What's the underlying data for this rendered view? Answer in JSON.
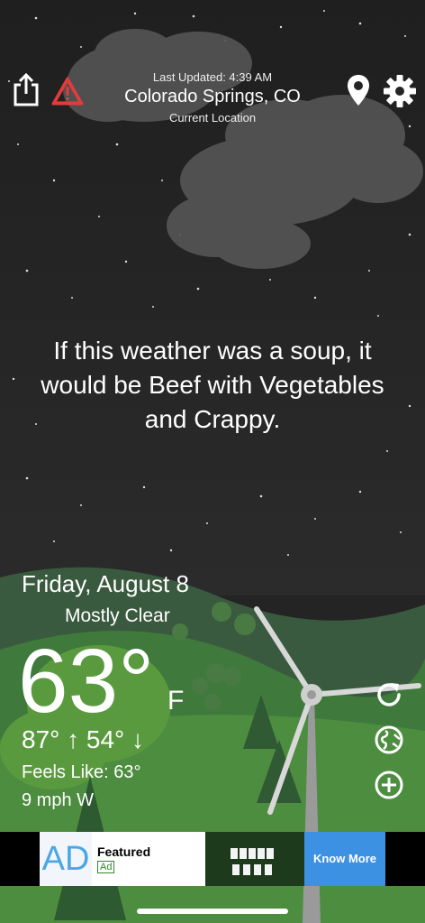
{
  "header": {
    "last_updated": "Last Updated: 4:39 AM",
    "city": "Colorado Springs, CO",
    "location_label": "Current Location"
  },
  "quote": "If this weather was a soup, it would be Beef with Vegetables and Crappy.",
  "current": {
    "date": "Friday, August 8",
    "condition": "Mostly Clear",
    "temperature": "63°",
    "unit": "F",
    "high_low": "87° ↑  54° ↓",
    "feels_like": "Feels Like: 63°",
    "wind": "9 mph W"
  },
  "ad": {
    "logo": "AD",
    "title": "Featured",
    "tag": "Ad",
    "cta": "Know More"
  },
  "icons": {
    "share": "share-icon",
    "alert": "alert-icon",
    "location": "location-pin-icon",
    "settings": "gear-icon",
    "condition": "moon-icon",
    "refresh": "refresh-icon",
    "globe": "globe-icon",
    "add": "add-icon"
  },
  "colors": {
    "sky": "#242424",
    "alert": "#e23b3b",
    "ad_cta": "#3d91e3",
    "moon": "#4aa7e6"
  }
}
